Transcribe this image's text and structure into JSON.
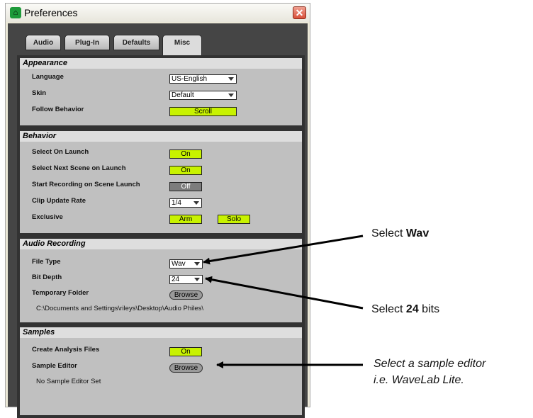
{
  "window": {
    "title": "Preferences",
    "close_glyph": "✕"
  },
  "tabs": [
    {
      "label": "Audio",
      "active": false
    },
    {
      "label": "Plug-In",
      "active": false
    },
    {
      "label": "Defaults",
      "active": false
    },
    {
      "label": "Misc",
      "active": true
    }
  ],
  "appearance": {
    "header": "Appearance",
    "language_label": "Language",
    "language_value": "US-English",
    "skin_label": "Skin",
    "skin_value": "Default",
    "follow_label": "Follow Behavior",
    "follow_value": "Scroll"
  },
  "behavior": {
    "header": "Behavior",
    "select_launch_label": "Select On Launch",
    "select_launch_value": "On",
    "next_scene_label": "Select Next Scene on Launch",
    "next_scene_value": "On",
    "start_rec_label": "Start Recording on Scene Launch",
    "start_rec_value": "Off",
    "clip_rate_label": "Clip Update Rate",
    "clip_rate_value": "1/4",
    "exclusive_label": "Exclusive",
    "exclusive_arm": "Arm",
    "exclusive_solo": "Solo"
  },
  "audio_recording": {
    "header": "Audio Recording",
    "file_type_label": "File Type",
    "file_type_value": "Wav",
    "bit_depth_label": "Bit Depth",
    "bit_depth_value": "24",
    "temp_folder_label": "Temporary Folder",
    "browse_label": "Browse",
    "temp_folder_path": "C:\\Documents and Settings\\rileys\\Desktop\\Audio Philes\\"
  },
  "samples": {
    "header": "Samples",
    "analysis_label": "Create Analysis Files",
    "analysis_value": "On",
    "editor_label": "Sample Editor",
    "browse_label": "Browse",
    "editor_status": "No Sample Editor Set"
  },
  "callouts": {
    "wav_prefix": "Select ",
    "wav_bold": "Wav",
    "bits_prefix": "Select ",
    "bits_bold": "24",
    "bits_suffix": " bits",
    "editor_line1": "Select a sample editor",
    "editor_line2": "i.e. WaveLab Lite."
  },
  "colors": {
    "accent_green": "#c8f200",
    "panel_dark": "#323232",
    "section_gray": "#c0c0c0"
  }
}
